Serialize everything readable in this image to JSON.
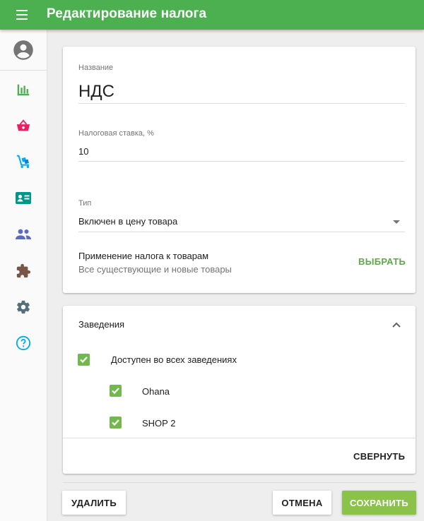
{
  "appbar": {
    "title": "Редактирование налога"
  },
  "sidebar": {
    "items": [
      {
        "icon": "account-circle-icon",
        "color": "#757575"
      },
      {
        "icon": "bar-chart-icon",
        "color": "#4caf50"
      },
      {
        "icon": "basket-icon",
        "color": "#e91e63"
      },
      {
        "icon": "cart-icon",
        "color": "#03a9f4"
      },
      {
        "icon": "id-card-icon",
        "color": "#009688"
      },
      {
        "icon": "people-icon",
        "color": "#5c6bc0"
      },
      {
        "icon": "puzzle-icon",
        "color": "#795548"
      },
      {
        "icon": "gear-icon",
        "color": "#546e7a"
      },
      {
        "icon": "help-icon",
        "color": "#03a9f4"
      }
    ]
  },
  "form": {
    "name_label": "Название",
    "name_value": "НДС",
    "rate_label": "Налоговая ставка, %",
    "rate_value": "10",
    "type_label": "Тип",
    "type_value": "Включен в цену товара",
    "apply_title": "Применение налога к товарам",
    "apply_subtitle": "Все существующие и новые товары",
    "apply_button": "ВЫБРАТЬ"
  },
  "stores": {
    "title": "Заведения",
    "all_label": "Доступен во всех заведениях",
    "items": [
      {
        "label": "Ohana",
        "checked": true
      },
      {
        "label": "SHOP 2",
        "checked": true
      }
    ],
    "collapse_button": "СВЕРНУТЬ"
  },
  "footer": {
    "delete_button": "УДАЛИТЬ",
    "cancel_button": "ОТМЕНА",
    "save_button": "СОХРАНИТЬ"
  },
  "colors": {
    "appbar": "#4caf50",
    "accent": "#8bc34a",
    "checkbox": "#72b84e",
    "link": "#5da74d"
  }
}
